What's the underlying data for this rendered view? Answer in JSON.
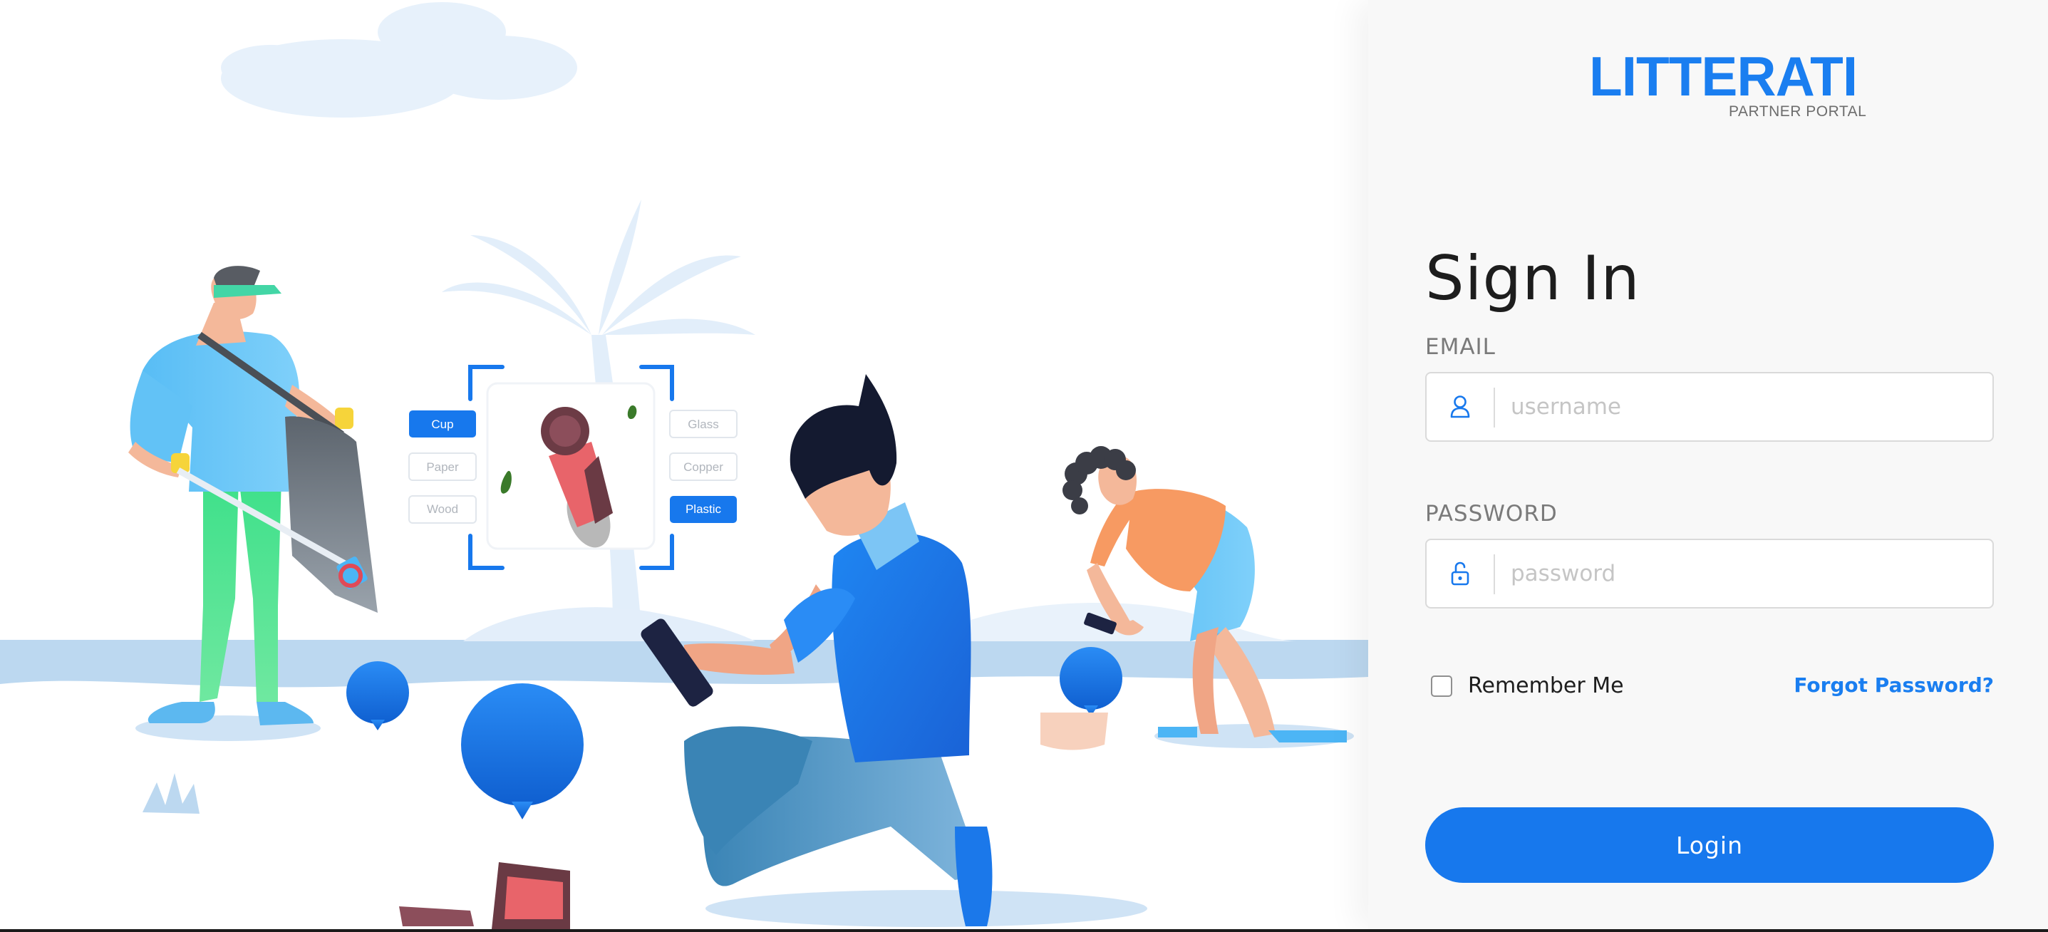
{
  "brand": {
    "name": "LITTERATI",
    "subtitle": "PARTNER PORTAL",
    "color": "#1a7ef0"
  },
  "illustration": {
    "left_tags": [
      "Cup",
      "Paper",
      "Wood"
    ],
    "right_tags": [
      "Glass",
      "Copper",
      "Plastic"
    ],
    "selected_left": "Cup",
    "selected_right": "Plastic"
  },
  "form": {
    "title": "Sign In",
    "email_label": "EMAIL",
    "email_placeholder": "username",
    "email_icon": "user-icon",
    "password_label": "PASSWORD",
    "password_placeholder": "password",
    "password_icon": "unlock-icon",
    "remember_label": "Remember Me",
    "remember_checked": false,
    "forgot_label": "Forgot Password?",
    "login_label": "Login"
  },
  "colors": {
    "accent": "#1778ed",
    "panel_bg": "#f8f8f8"
  }
}
